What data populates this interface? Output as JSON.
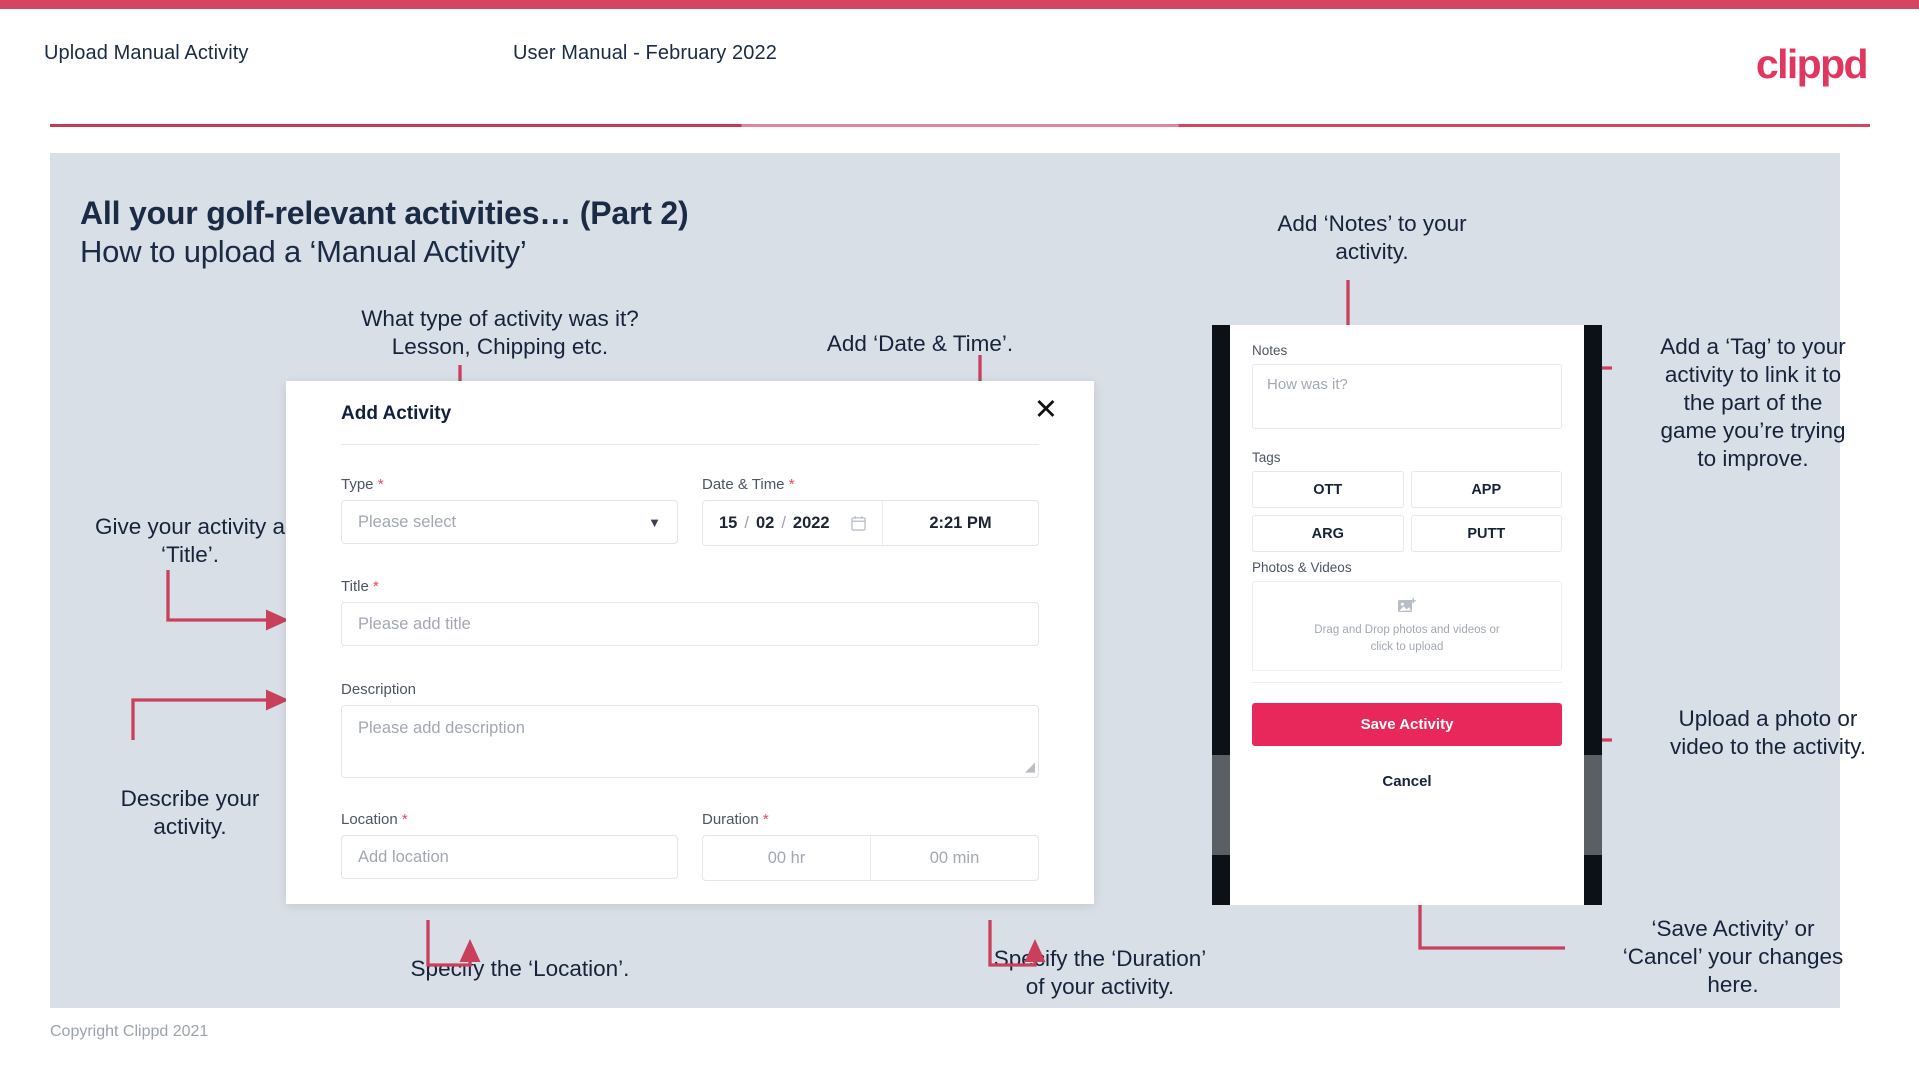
{
  "header": {
    "title": "Upload Manual Activity",
    "subtitle": "User Manual - February 2022",
    "logo": "clippd"
  },
  "slide": {
    "title": "All your golf-relevant activities… (Part 2)",
    "subtitle": "How to upload a ‘Manual Activity’"
  },
  "footer": {
    "copyright": "Copyright Clippd 2021"
  },
  "annotations": {
    "type": "What type of activity was it?\nLesson, Chipping etc.",
    "date_time": "Add ‘Date & Time’.",
    "title_field": "Give your activity a\n‘Title’.",
    "description_field": "Describe your\nactivity.",
    "location": "Specify the ‘Location’.",
    "duration": "Specify the ‘Duration’\nof your activity.",
    "notes": "Add ‘Notes’ to your\nactivity.",
    "tags": "Add a ‘Tag’ to your\nactivity to link it to\nthe part of the\ngame you’re trying\nto improve.",
    "upload": "Upload a photo or\nvideo to the activity.",
    "save_cancel": "‘Save Activity’ or\n‘Cancel’ your changes\nhere."
  },
  "modal": {
    "title": "Add Activity",
    "close_icon": "close-icon",
    "fields": {
      "type": {
        "label": "Type",
        "required": "*",
        "placeholder": "Please select",
        "chevron": "chevron-down-icon"
      },
      "date_time": {
        "label": "Date & Time",
        "required": "*",
        "day": "15",
        "sep1": "/",
        "month": "02",
        "sep2": "/",
        "year": "2022",
        "calendar_icon": "calendar-icon",
        "time": "2:21 PM"
      },
      "title": {
        "label": "Title",
        "required": "*",
        "placeholder": "Please add title"
      },
      "description": {
        "label": "Description",
        "placeholder": "Please add description"
      },
      "location": {
        "label": "Location",
        "required": "*",
        "placeholder": "Add location"
      },
      "duration": {
        "label": "Duration",
        "required": "*",
        "hours_placeholder": "00 hr",
        "minutes_placeholder": "00 min"
      }
    }
  },
  "phone": {
    "notes": {
      "label": "Notes",
      "placeholder": "How was it?"
    },
    "tags": {
      "label": "Tags",
      "items": [
        "OTT",
        "APP",
        "ARG",
        "PUTT"
      ]
    },
    "photos": {
      "label": "Photos & Videos",
      "icon": "image-add-icon",
      "drop_text": "Drag and Drop photos and videos or\nclick to upload"
    },
    "save_label": "Save Activity",
    "cancel_label": "Cancel"
  },
  "colors": {
    "brand_pink": "#e8285a",
    "accent_red": "#d6455f",
    "arrow": "#c9405c",
    "slide_bg": "#d9dfe7",
    "ink": "#16233a"
  }
}
